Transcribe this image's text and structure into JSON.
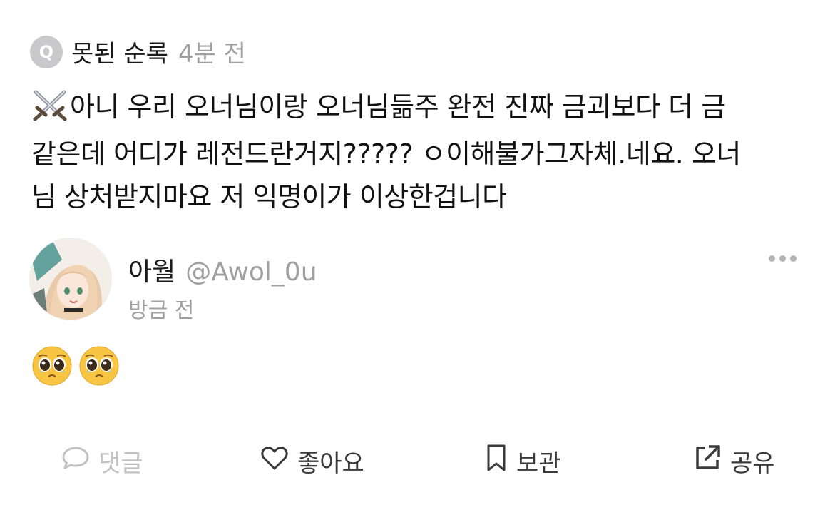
{
  "question": {
    "badge": "Q",
    "author": "못된 순록",
    "time": "4분 전",
    "emoji_icon": "crossed-swords-icon",
    "lines": [
      "아니 우리 오너님이랑 오너님듦주 완전 진짜 금괴보다 더 금",
      "같은데 어디가 레전드란거지????? ㅇ이해불가그자체.네요. 오너",
      "님 상처받지마요 저 익명이가 이상한겁니다"
    ]
  },
  "answer": {
    "name": "아월",
    "handle": "@Awol_0u",
    "time": "방금 전",
    "emojis": [
      "pleading-face-icon",
      "pleading-face-icon"
    ]
  },
  "actions": {
    "comment": "댓글",
    "like": "좋아요",
    "save": "보관",
    "share": "공유"
  },
  "colors": {
    "muted": "#a0a0a4",
    "disabled": "#c2c2c6",
    "text": "#111111"
  }
}
